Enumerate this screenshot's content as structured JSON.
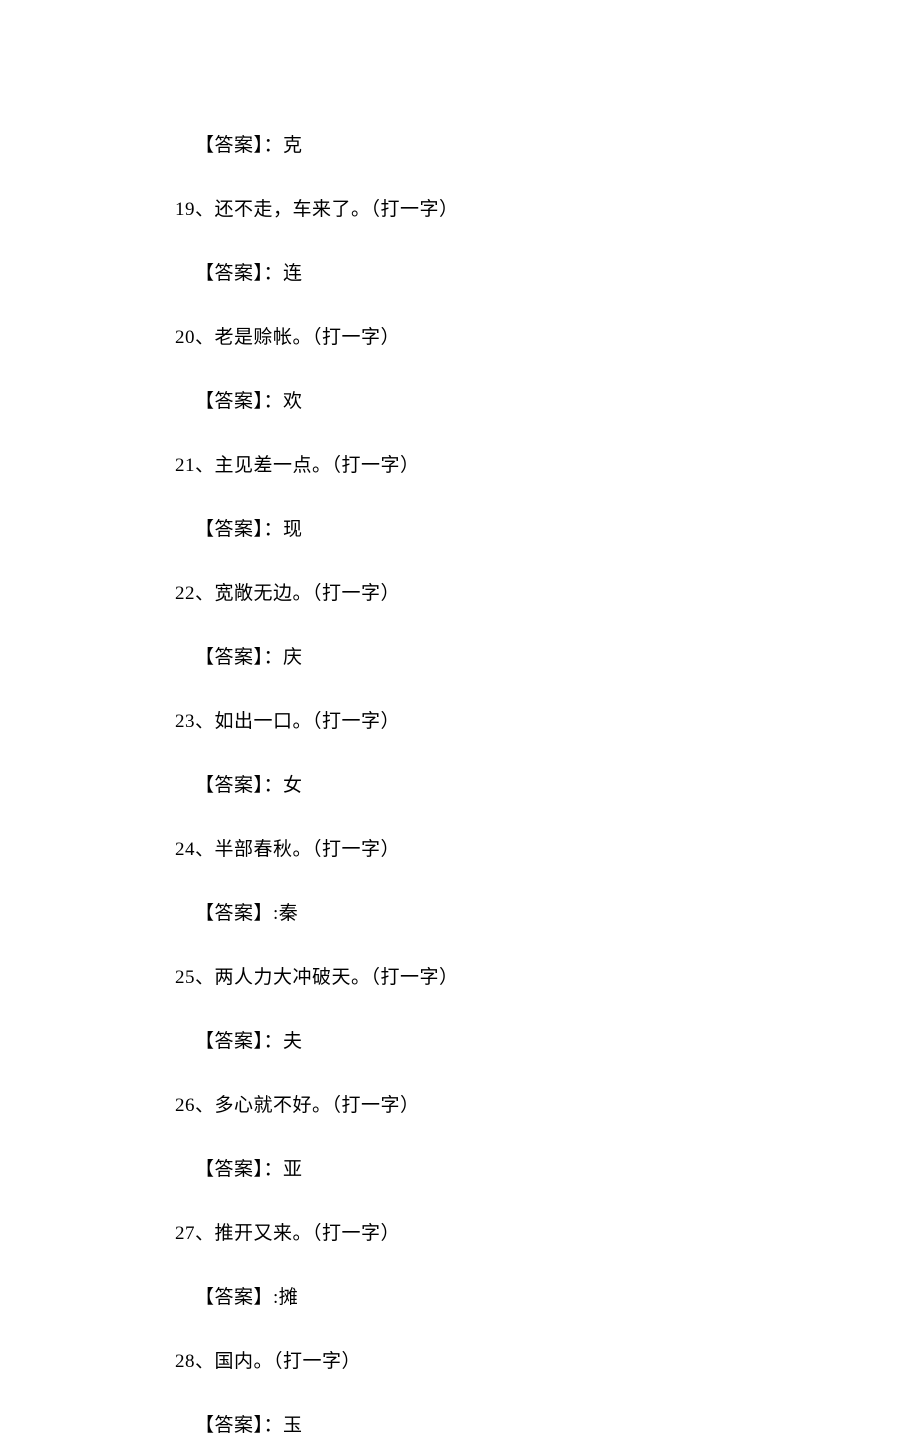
{
  "lines": [
    {
      "type": "answer",
      "text": "【答案】：克"
    },
    {
      "type": "question",
      "text": "19、还不走，车来了。（打一字）"
    },
    {
      "type": "answer",
      "text": "【答案】：连"
    },
    {
      "type": "question",
      "text": "20、老是赊帐。（打一字）"
    },
    {
      "type": "answer",
      "text": "【答案】：欢"
    },
    {
      "type": "question",
      "text": "21、主见差一点。（打一字）"
    },
    {
      "type": "answer",
      "text": "【答案】：现"
    },
    {
      "type": "question",
      "text": "22、宽敞无边。（打一字）"
    },
    {
      "type": "answer",
      "text": "【答案】：庆"
    },
    {
      "type": "question",
      "text": "23、如出一口。（打一字）"
    },
    {
      "type": "answer",
      "text": "【答案】：女"
    },
    {
      "type": "question",
      "text": "24、半部春秋。（打一字）"
    },
    {
      "type": "answer",
      "text": "【答案】:秦"
    },
    {
      "type": "question",
      "text": "25、两人力大冲破天。（打一字）"
    },
    {
      "type": "answer",
      "text": "【答案】：夫"
    },
    {
      "type": "question",
      "text": "26、多心就不好。（打一字）"
    },
    {
      "type": "answer",
      "text": "【答案】：亚"
    },
    {
      "type": "question",
      "text": "27、推开又来。（打一字）"
    },
    {
      "type": "answer",
      "text": "【答案】:摊"
    },
    {
      "type": "question",
      "text": "28、国内。（打一字）"
    },
    {
      "type": "answer",
      "text": "【答案】：玉"
    }
  ]
}
